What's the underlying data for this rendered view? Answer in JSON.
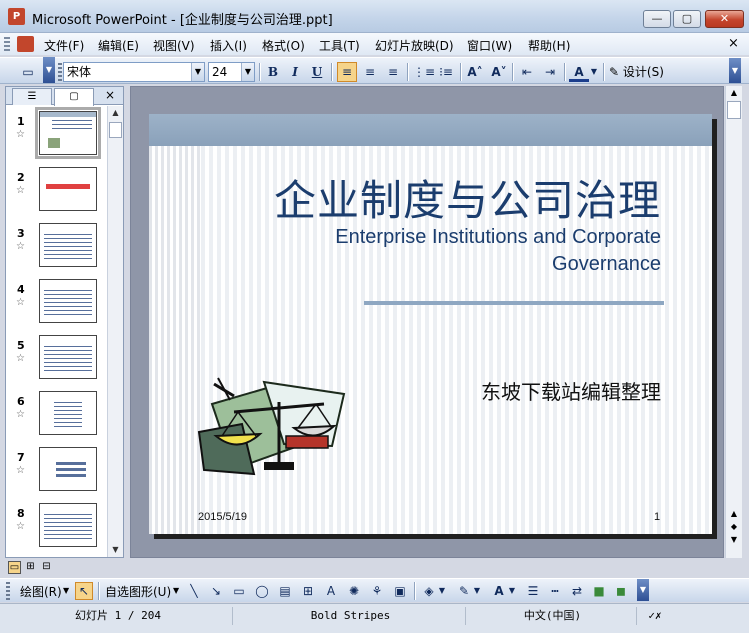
{
  "window": {
    "title": "Microsoft PowerPoint - [企业制度与公司治理.ppt]",
    "app_icon": "P",
    "controls": {
      "minimize": "—",
      "maximize": "▢",
      "close": "✕"
    }
  },
  "menu": {
    "items": [
      "文件(F)",
      "编辑(E)",
      "视图(V)",
      "插入(I)",
      "格式(O)",
      "工具(T)",
      "幻灯片放映(D)",
      "窗口(W)",
      "帮助(H)"
    ],
    "close_glyph": "×"
  },
  "toolbar": {
    "font_name": "宋体",
    "font_size": "24",
    "bold": "B",
    "italic": "I",
    "underline": "U",
    "design_label": "设计(S)",
    "icons": [
      "new-icon",
      "bold-icon",
      "italic-icon",
      "underline-icon",
      "align-left-icon",
      "align-center-icon",
      "align-right-icon",
      "numbering-icon",
      "bullets-icon",
      "grow-font-icon",
      "shrink-font-icon",
      "decrease-indent-icon",
      "increase-indent-icon",
      "font-color-icon",
      "design-icon"
    ]
  },
  "outline_pane": {
    "tabs": [
      "outline-tab",
      "slides-tab"
    ],
    "close_glyph": "×",
    "slides": [
      {
        "num": "1",
        "kind": "title"
      },
      {
        "num": "2",
        "kind": "red"
      },
      {
        "num": "3",
        "kind": "text"
      },
      {
        "num": "4",
        "kind": "text"
      },
      {
        "num": "5",
        "kind": "text"
      },
      {
        "num": "6",
        "kind": "text"
      },
      {
        "num": "7",
        "kind": "text"
      },
      {
        "num": "8",
        "kind": "text"
      }
    ],
    "star_glyph": "☆"
  },
  "slide": {
    "title_zh": "企业制度与公司治理",
    "title_en": "Enterprise Institutions and Corporate Governance",
    "subtitle": "东坡下载站编辑整理",
    "date": "2015/5/19",
    "page_number": "1",
    "colors": {
      "title": "#1b3d6e",
      "band": "#9db2c8",
      "rule": "#8ea7c2"
    }
  },
  "drawing_toolbar": {
    "draw_label": "绘图(R)",
    "autoshapes_label": "自选图形(U)"
  },
  "status": {
    "slide_info": "幻灯片 1 / 204",
    "design": "Bold Stripes",
    "language": "中文(中国)"
  }
}
